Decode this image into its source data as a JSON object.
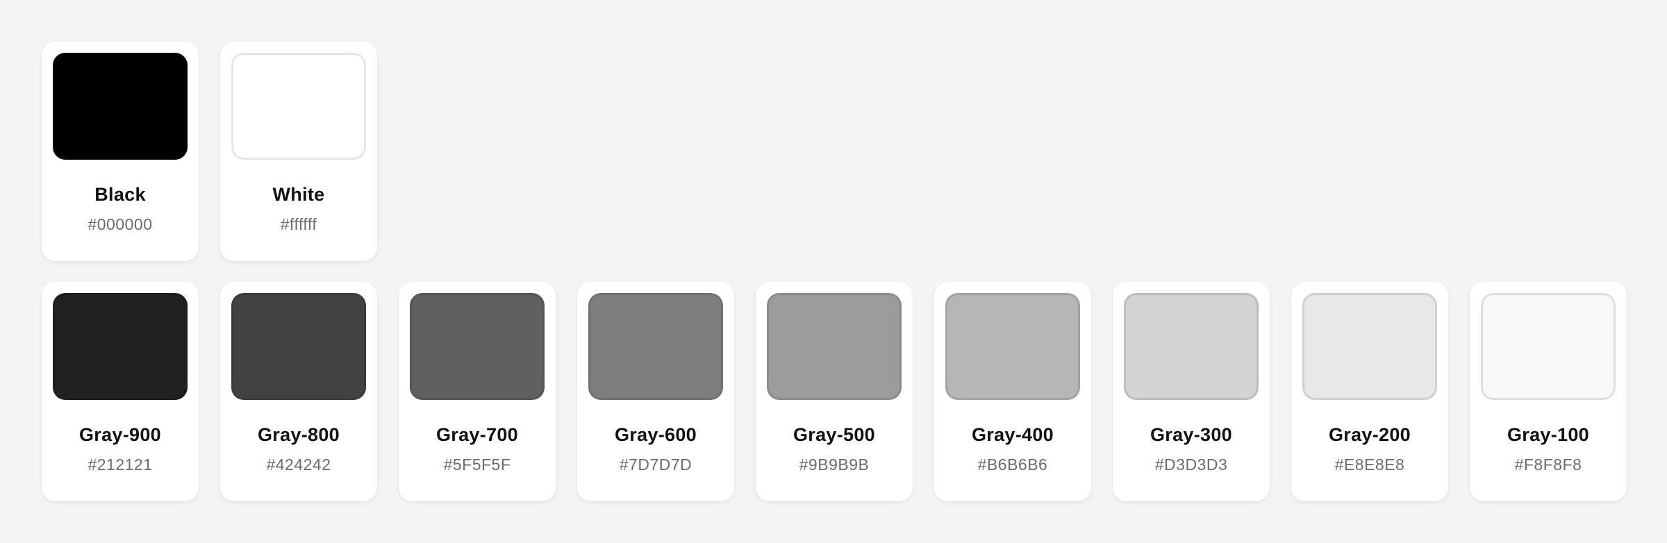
{
  "base_colors": [
    {
      "name": "Black",
      "hex": "#000000",
      "color": "#000000"
    },
    {
      "name": "White",
      "hex": "#ffffff",
      "color": "#ffffff"
    }
  ],
  "gray_colors": [
    {
      "name": "Gray-900",
      "hex": "#212121",
      "color": "#212121"
    },
    {
      "name": "Gray-800",
      "hex": "#424242",
      "color": "#424242"
    },
    {
      "name": "Gray-700",
      "hex": "#5F5F5F",
      "color": "#5F5F5F"
    },
    {
      "name": "Gray-600",
      "hex": "#7D7D7D",
      "color": "#7D7D7D"
    },
    {
      "name": "Gray-500",
      "hex": "#9B9B9B",
      "color": "#9B9B9B"
    },
    {
      "name": "Gray-400",
      "hex": "#B6B6B6",
      "color": "#B6B6B6"
    },
    {
      "name": "Gray-300",
      "hex": "#D3D3D3",
      "color": "#D3D3D3"
    },
    {
      "name": "Gray-200",
      "hex": "#E8E8E8",
      "color": "#E8E8E8"
    },
    {
      "name": "Gray-100",
      "hex": "#F8F8F8",
      "color": "#F8F8F8"
    }
  ]
}
